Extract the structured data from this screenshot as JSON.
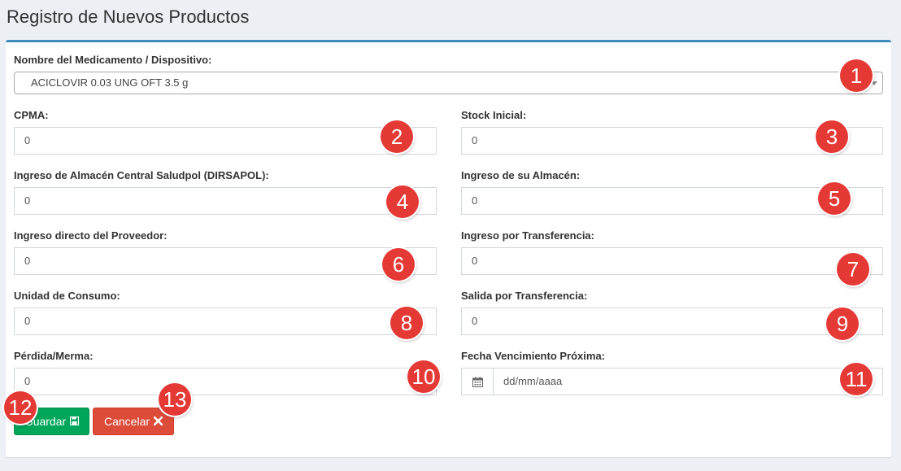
{
  "page": {
    "title": "Registro de Nuevos Productos"
  },
  "form": {
    "product": {
      "label": "Nombre del Medicamento / Dispositivo:",
      "value": "ACICLOVIR 0.03 UNG OFT 3.5 g"
    },
    "cpma": {
      "label": "CPMA:",
      "value": "0"
    },
    "stock_inicial": {
      "label": "Stock Inicial:",
      "value": "0"
    },
    "ingreso_central": {
      "label": "Ingreso de Almacén Central Saludpol (DIRSAPOL):",
      "value": "0"
    },
    "ingreso_almacen": {
      "label": "Ingreso de su Almacén:",
      "value": "0"
    },
    "ingreso_proveedor": {
      "label": "Ingreso directo del Proveedor:",
      "value": "0"
    },
    "ingreso_transferencia": {
      "label": "Ingreso por Transferencia:",
      "value": "0"
    },
    "unidad_consumo": {
      "label": "Unidad de Consumo:",
      "value": "0"
    },
    "salida_transferencia": {
      "label": "Salida por Transferencia:",
      "value": "0"
    },
    "perdida_merma": {
      "label": "Pérdida/Merma:",
      "value": "0"
    },
    "fecha_vencimiento": {
      "label": "Fecha Vencimiento Próxima:",
      "placeholder": "dd/mm/aaaa",
      "icon": "calendar-icon"
    }
  },
  "buttons": {
    "save": {
      "label": "Guardar",
      "icon": "save-icon",
      "color": "#00a65a"
    },
    "cancel": {
      "label": "Cancelar",
      "icon": "close-icon",
      "color": "#dd4b39"
    }
  },
  "annotations": [
    "1",
    "2",
    "3",
    "4",
    "5",
    "6",
    "7",
    "8",
    "9",
    "10",
    "11",
    "12",
    "13"
  ],
  "colors": {
    "accent": "#3c8dbc",
    "badge": "#e53935"
  }
}
